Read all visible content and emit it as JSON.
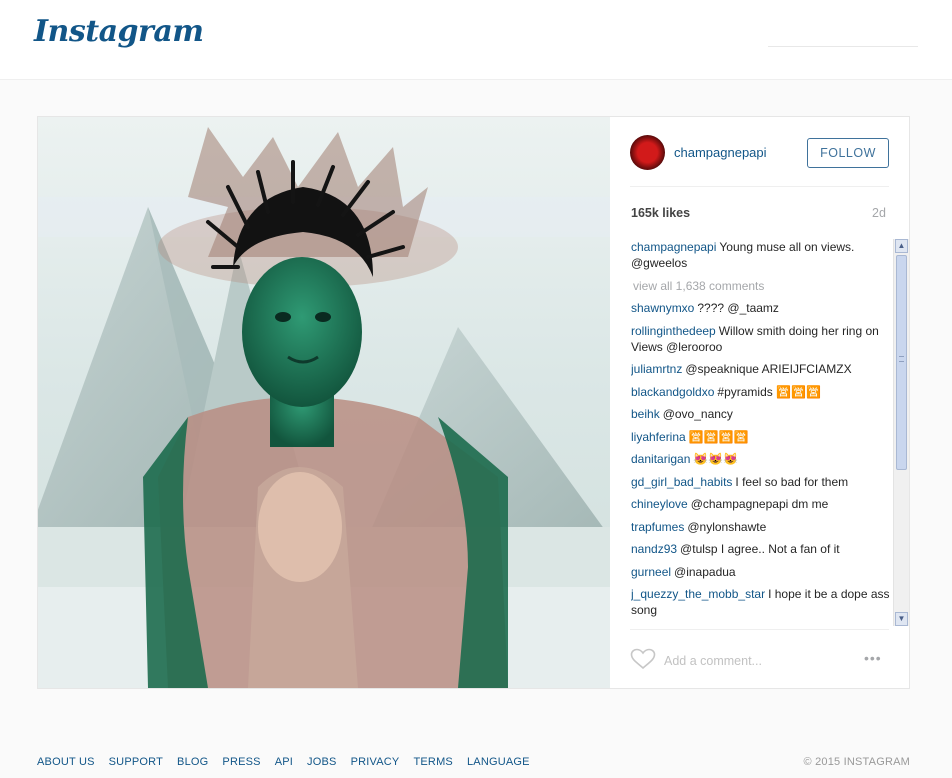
{
  "header": {
    "logo": "Instagram"
  },
  "post": {
    "username": "champagnepapi",
    "follow_label": "FOLLOW",
    "likes": "165k likes",
    "age": "2d",
    "view_all": "view all 1,638 comments",
    "caption": {
      "user": "champagnepapi",
      "text": "Young muse all on views. @gweelos"
    },
    "comments": [
      {
        "user": "shawnymxo",
        "text": "???? @_taamz"
      },
      {
        "user": "rollinginthedeep",
        "text": "Willow smith doing her ring on Views @lerooroo"
      },
      {
        "user": "juliamrtnz",
        "text": "@speaknique ARIEIJFCIAMZX"
      },
      {
        "user": "blackandgoldxo",
        "text": "#pyramids 🈺🈺🈺"
      },
      {
        "user": "beihk",
        "text": "@ovo_nancy"
      },
      {
        "user": "liyahferina",
        "text": "🈺🈺🈺🈺"
      },
      {
        "user": "danitarigan",
        "text": "😻😻😻"
      },
      {
        "user": "gd_girl_bad_habits",
        "text": "I feel so bad for them"
      },
      {
        "user": "chineylove",
        "text": "@champagnepapi dm me"
      },
      {
        "user": "trapfumes",
        "text": "@nylonshawte"
      },
      {
        "user": "nandz93",
        "text": "@tulsp I agree.. Not a fan of it"
      },
      {
        "user": "gurneel",
        "text": "@inapadua"
      },
      {
        "user": "j_quezzy_the_mobb_star",
        "text": "I hope it be a dope ass song"
      }
    ],
    "add_comment_placeholder": "Add a comment...",
    "more_label": "•••"
  },
  "footer": {
    "links": [
      "ABOUT US",
      "SUPPORT",
      "BLOG",
      "PRESS",
      "API",
      "JOBS",
      "PRIVACY",
      "TERMS",
      "LANGUAGE"
    ],
    "copyright": "© 2015 INSTAGRAM"
  },
  "colors": {
    "brand": "#125688",
    "follow_border": "#3f729b",
    "muted": "#a5a7aa"
  },
  "icons": {
    "like": "heart-icon",
    "more": "more-options-icon"
  }
}
